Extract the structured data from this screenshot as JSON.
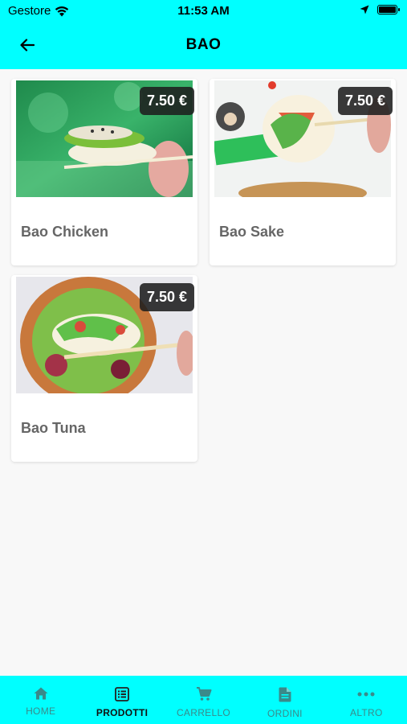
{
  "status_bar": {
    "carrier": "Gestore",
    "time": "11:53 AM"
  },
  "header": {
    "title": "BAO",
    "background": "#00ffff"
  },
  "products": [
    {
      "name": "Bao Chicken",
      "price": "7.50 €"
    },
    {
      "name": "Bao Sake",
      "price": "7.50 €"
    },
    {
      "name": "Bao Tuna",
      "price": "7.50 €"
    }
  ],
  "tabbar": {
    "tabs": [
      {
        "label": "HOME",
        "icon": "home-icon"
      },
      {
        "label": "PRODOTTI",
        "icon": "list-icon",
        "active": true
      },
      {
        "label": "CARRELLO",
        "icon": "cart-icon"
      },
      {
        "label": "ORDINI",
        "icon": "document-icon"
      },
      {
        "label": "ALTRO",
        "icon": "more-icon"
      }
    ]
  }
}
